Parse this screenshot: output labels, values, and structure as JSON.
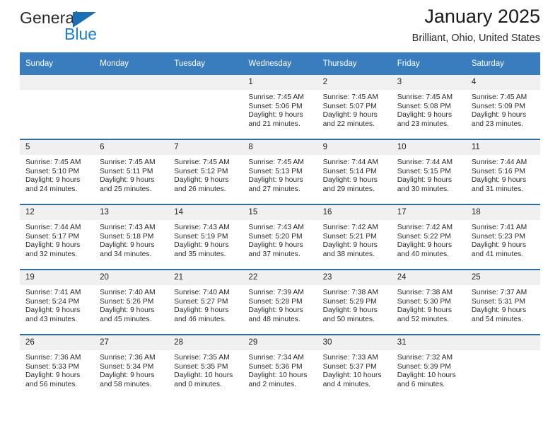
{
  "brand": {
    "name_top": "General",
    "name_bottom": "Blue",
    "accent_color": "#1a7fd4",
    "triangle_color": "#1a6fb5"
  },
  "header": {
    "title": "January 2025",
    "subtitle": "Brilliant, Ohio, United States",
    "header_bg": "#3a7dbf",
    "row_separator": "#2e6da4",
    "daynum_bg": "#f0f0f0"
  },
  "weekdays": [
    "Sunday",
    "Monday",
    "Tuesday",
    "Wednesday",
    "Thursday",
    "Friday",
    "Saturday"
  ],
  "weeks": [
    [
      {
        "day": "",
        "sunrise": "",
        "sunset": "",
        "daylight_1": "",
        "daylight_2": ""
      },
      {
        "day": "",
        "sunrise": "",
        "sunset": "",
        "daylight_1": "",
        "daylight_2": ""
      },
      {
        "day": "",
        "sunrise": "",
        "sunset": "",
        "daylight_1": "",
        "daylight_2": ""
      },
      {
        "day": "1",
        "sunrise": "Sunrise: 7:45 AM",
        "sunset": "Sunset: 5:06 PM",
        "daylight_1": "Daylight: 9 hours",
        "daylight_2": "and 21 minutes."
      },
      {
        "day": "2",
        "sunrise": "Sunrise: 7:45 AM",
        "sunset": "Sunset: 5:07 PM",
        "daylight_1": "Daylight: 9 hours",
        "daylight_2": "and 22 minutes."
      },
      {
        "day": "3",
        "sunrise": "Sunrise: 7:45 AM",
        "sunset": "Sunset: 5:08 PM",
        "daylight_1": "Daylight: 9 hours",
        "daylight_2": "and 23 minutes."
      },
      {
        "day": "4",
        "sunrise": "Sunrise: 7:45 AM",
        "sunset": "Sunset: 5:09 PM",
        "daylight_1": "Daylight: 9 hours",
        "daylight_2": "and 23 minutes."
      }
    ],
    [
      {
        "day": "5",
        "sunrise": "Sunrise: 7:45 AM",
        "sunset": "Sunset: 5:10 PM",
        "daylight_1": "Daylight: 9 hours",
        "daylight_2": "and 24 minutes."
      },
      {
        "day": "6",
        "sunrise": "Sunrise: 7:45 AM",
        "sunset": "Sunset: 5:11 PM",
        "daylight_1": "Daylight: 9 hours",
        "daylight_2": "and 25 minutes."
      },
      {
        "day": "7",
        "sunrise": "Sunrise: 7:45 AM",
        "sunset": "Sunset: 5:12 PM",
        "daylight_1": "Daylight: 9 hours",
        "daylight_2": "and 26 minutes."
      },
      {
        "day": "8",
        "sunrise": "Sunrise: 7:45 AM",
        "sunset": "Sunset: 5:13 PM",
        "daylight_1": "Daylight: 9 hours",
        "daylight_2": "and 27 minutes."
      },
      {
        "day": "9",
        "sunrise": "Sunrise: 7:44 AM",
        "sunset": "Sunset: 5:14 PM",
        "daylight_1": "Daylight: 9 hours",
        "daylight_2": "and 29 minutes."
      },
      {
        "day": "10",
        "sunrise": "Sunrise: 7:44 AM",
        "sunset": "Sunset: 5:15 PM",
        "daylight_1": "Daylight: 9 hours",
        "daylight_2": "and 30 minutes."
      },
      {
        "day": "11",
        "sunrise": "Sunrise: 7:44 AM",
        "sunset": "Sunset: 5:16 PM",
        "daylight_1": "Daylight: 9 hours",
        "daylight_2": "and 31 minutes."
      }
    ],
    [
      {
        "day": "12",
        "sunrise": "Sunrise: 7:44 AM",
        "sunset": "Sunset: 5:17 PM",
        "daylight_1": "Daylight: 9 hours",
        "daylight_2": "and 32 minutes."
      },
      {
        "day": "13",
        "sunrise": "Sunrise: 7:43 AM",
        "sunset": "Sunset: 5:18 PM",
        "daylight_1": "Daylight: 9 hours",
        "daylight_2": "and 34 minutes."
      },
      {
        "day": "14",
        "sunrise": "Sunrise: 7:43 AM",
        "sunset": "Sunset: 5:19 PM",
        "daylight_1": "Daylight: 9 hours",
        "daylight_2": "and 35 minutes."
      },
      {
        "day": "15",
        "sunrise": "Sunrise: 7:43 AM",
        "sunset": "Sunset: 5:20 PM",
        "daylight_1": "Daylight: 9 hours",
        "daylight_2": "and 37 minutes."
      },
      {
        "day": "16",
        "sunrise": "Sunrise: 7:42 AM",
        "sunset": "Sunset: 5:21 PM",
        "daylight_1": "Daylight: 9 hours",
        "daylight_2": "and 38 minutes."
      },
      {
        "day": "17",
        "sunrise": "Sunrise: 7:42 AM",
        "sunset": "Sunset: 5:22 PM",
        "daylight_1": "Daylight: 9 hours",
        "daylight_2": "and 40 minutes."
      },
      {
        "day": "18",
        "sunrise": "Sunrise: 7:41 AM",
        "sunset": "Sunset: 5:23 PM",
        "daylight_1": "Daylight: 9 hours",
        "daylight_2": "and 41 minutes."
      }
    ],
    [
      {
        "day": "19",
        "sunrise": "Sunrise: 7:41 AM",
        "sunset": "Sunset: 5:24 PM",
        "daylight_1": "Daylight: 9 hours",
        "daylight_2": "and 43 minutes."
      },
      {
        "day": "20",
        "sunrise": "Sunrise: 7:40 AM",
        "sunset": "Sunset: 5:26 PM",
        "daylight_1": "Daylight: 9 hours",
        "daylight_2": "and 45 minutes."
      },
      {
        "day": "21",
        "sunrise": "Sunrise: 7:40 AM",
        "sunset": "Sunset: 5:27 PM",
        "daylight_1": "Daylight: 9 hours",
        "daylight_2": "and 46 minutes."
      },
      {
        "day": "22",
        "sunrise": "Sunrise: 7:39 AM",
        "sunset": "Sunset: 5:28 PM",
        "daylight_1": "Daylight: 9 hours",
        "daylight_2": "and 48 minutes."
      },
      {
        "day": "23",
        "sunrise": "Sunrise: 7:38 AM",
        "sunset": "Sunset: 5:29 PM",
        "daylight_1": "Daylight: 9 hours",
        "daylight_2": "and 50 minutes."
      },
      {
        "day": "24",
        "sunrise": "Sunrise: 7:38 AM",
        "sunset": "Sunset: 5:30 PM",
        "daylight_1": "Daylight: 9 hours",
        "daylight_2": "and 52 minutes."
      },
      {
        "day": "25",
        "sunrise": "Sunrise: 7:37 AM",
        "sunset": "Sunset: 5:31 PM",
        "daylight_1": "Daylight: 9 hours",
        "daylight_2": "and 54 minutes."
      }
    ],
    [
      {
        "day": "26",
        "sunrise": "Sunrise: 7:36 AM",
        "sunset": "Sunset: 5:33 PM",
        "daylight_1": "Daylight: 9 hours",
        "daylight_2": "and 56 minutes."
      },
      {
        "day": "27",
        "sunrise": "Sunrise: 7:36 AM",
        "sunset": "Sunset: 5:34 PM",
        "daylight_1": "Daylight: 9 hours",
        "daylight_2": "and 58 minutes."
      },
      {
        "day": "28",
        "sunrise": "Sunrise: 7:35 AM",
        "sunset": "Sunset: 5:35 PM",
        "daylight_1": "Daylight: 10 hours",
        "daylight_2": "and 0 minutes."
      },
      {
        "day": "29",
        "sunrise": "Sunrise: 7:34 AM",
        "sunset": "Sunset: 5:36 PM",
        "daylight_1": "Daylight: 10 hours",
        "daylight_2": "and 2 minutes."
      },
      {
        "day": "30",
        "sunrise": "Sunrise: 7:33 AM",
        "sunset": "Sunset: 5:37 PM",
        "daylight_1": "Daylight: 10 hours",
        "daylight_2": "and 4 minutes."
      },
      {
        "day": "31",
        "sunrise": "Sunrise: 7:32 AM",
        "sunset": "Sunset: 5:39 PM",
        "daylight_1": "Daylight: 10 hours",
        "daylight_2": "and 6 minutes."
      },
      {
        "day": "",
        "sunrise": "",
        "sunset": "",
        "daylight_1": "",
        "daylight_2": ""
      }
    ]
  ]
}
